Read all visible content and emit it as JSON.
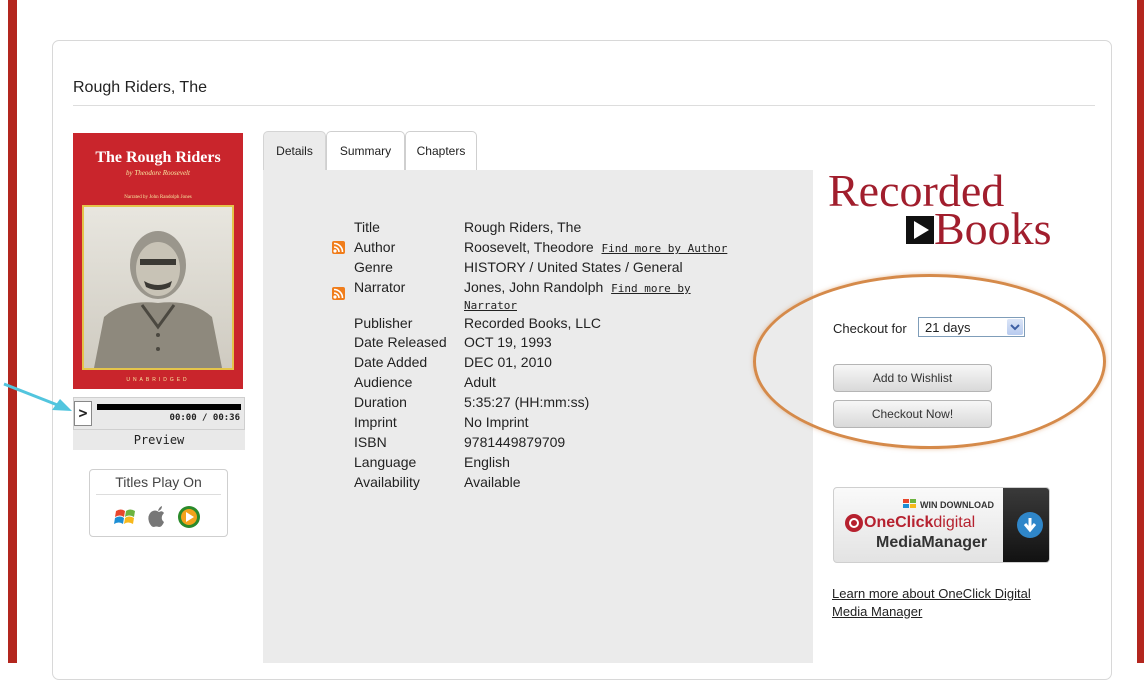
{
  "page": {
    "title": "Rough Riders, The"
  },
  "cover": {
    "title": "The Rough Riders",
    "author_line": "by Theodore Roosevelt",
    "narrator_line": "Narrated by John Randolph Jones",
    "edition": "UNABRIDGED"
  },
  "player": {
    "play_glyph": ">",
    "time": "00:00 / 00:36",
    "preview_label": "Preview",
    "progress": 0.0
  },
  "plays_on": {
    "title": "Titles Play On",
    "icons": [
      "windows-icon",
      "apple-icon",
      "media-player-icon"
    ]
  },
  "tabs": [
    {
      "label": "Details",
      "active": true
    },
    {
      "label": "Summary",
      "active": false
    },
    {
      "label": "Chapters",
      "active": false
    }
  ],
  "details": {
    "title": {
      "label": "Title",
      "value": "Rough Riders, The"
    },
    "author": {
      "label": "Author",
      "value": "Roosevelt, Theodore",
      "link": "Find more by Author"
    },
    "genre": {
      "label": "Genre",
      "value": "HISTORY / United States / General"
    },
    "narrator": {
      "label": "Narrator",
      "value": "Jones, John Randolph",
      "link_line1": "Find more by",
      "link_line2": "Narrator"
    },
    "publisher": {
      "label": "Publisher",
      "value": "Recorded Books, LLC"
    },
    "date_released": {
      "label": "Date Released",
      "value": "OCT 19, 1993"
    },
    "date_added": {
      "label": "Date Added",
      "value": "DEC 01, 2010"
    },
    "audience": {
      "label": "Audience",
      "value": "Adult"
    },
    "duration": {
      "label": "Duration",
      "value": "5:35:27 (HH:mm:ss)"
    },
    "imprint": {
      "label": "Imprint",
      "value": "No Imprint"
    },
    "isbn": {
      "label": "ISBN",
      "value": "9781449879709"
    },
    "language": {
      "label": "Language",
      "value": "English"
    },
    "availability": {
      "label": "Availability",
      "value": "Available"
    }
  },
  "logo": {
    "line1": "Recorded",
    "line2": "Books"
  },
  "checkout": {
    "label": "Checkout for",
    "selected": "21 days",
    "wishlist_button": "Add to Wishlist",
    "checkout_button": "Checkout Now!"
  },
  "oneclick": {
    "win_download": "WIN DOWNLOAD",
    "brand_a": "OneClick",
    "brand_b": "digital",
    "product": "MediaManager",
    "learn_more": "Learn more about OneClick Digital Media Manager"
  },
  "colors": {
    "brand_red": "#b3261e",
    "logo_red": "#a11e2d",
    "highlight_oval": "#d58a4a",
    "rss_orange": "#f07d1b",
    "arrow": "#52c5de"
  }
}
